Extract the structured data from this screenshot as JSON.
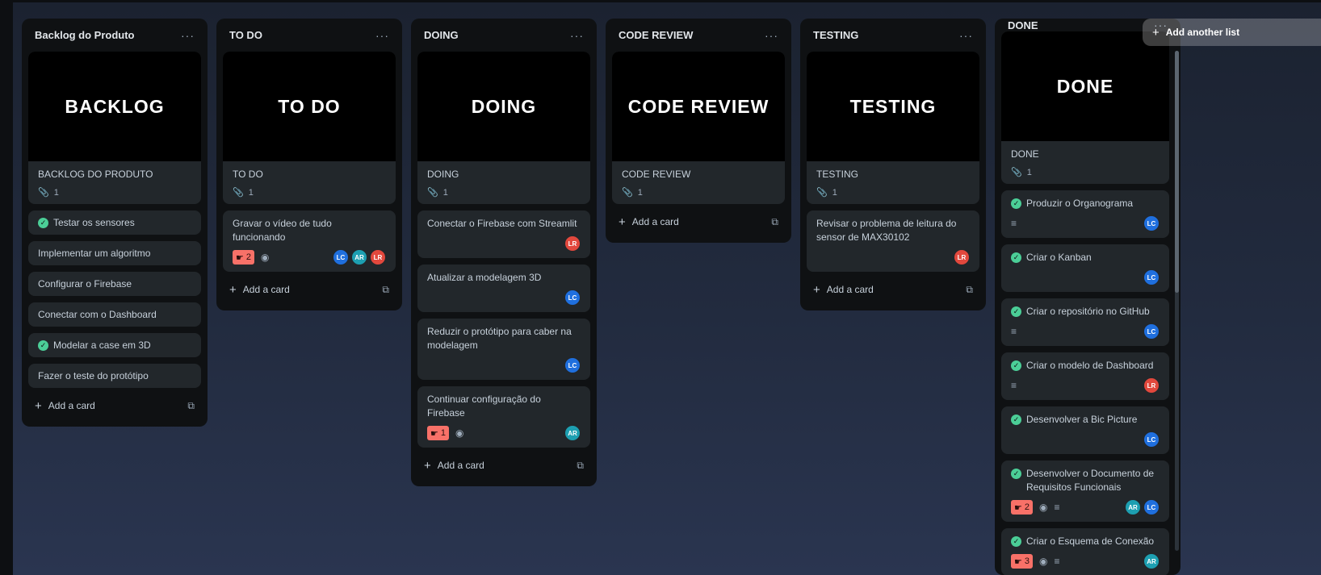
{
  "lists": [
    {
      "title": "Backlog do Produto",
      "cover_text": "BACKLOG",
      "cover_title": "BACKLOG DO PRODUTO",
      "attachments": "1",
      "cards": [
        {
          "title": "Testar os sensores",
          "done": true
        },
        {
          "title": "Implementar um algoritmo",
          "done": false
        },
        {
          "title": "Configurar o Firebase",
          "done": false
        },
        {
          "title": "Conectar com o Dashboard",
          "done": false
        },
        {
          "title": "Modelar a case em 3D",
          "done": true
        },
        {
          "title": "Fazer o teste do protótipo",
          "done": false
        }
      ],
      "add_card": "Add a card"
    },
    {
      "title": "TO DO",
      "cover_text": "TO DO",
      "cover_title": "TO DO",
      "attachments": "1",
      "cards": [
        {
          "title": "Gravar o vídeo de tudo funcionando",
          "badge": "2",
          "avatars": [
            "LC",
            "AR",
            "LR"
          ]
        }
      ],
      "add_card": "Add a card"
    },
    {
      "title": "DOING",
      "cover_text": "DOING",
      "cover_title": "DOING",
      "attachments": "1",
      "cards": [
        {
          "title": "Conectar o Firebase com Streamlit",
          "avatars": [
            "LR"
          ]
        },
        {
          "title": "Atualizar a modelagem 3D",
          "avatars": [
            "LC"
          ]
        },
        {
          "title": "Reduzir o protótipo para caber na modelagem",
          "avatars": [
            "LC"
          ]
        },
        {
          "title": "Continuar configuração do Firebase",
          "badge": "1",
          "avatars": [
            "AR"
          ]
        }
      ],
      "add_card": "Add a card"
    },
    {
      "title": "CODE REVIEW",
      "cover_text": "CODE REVIEW",
      "cover_title": "CODE REVIEW",
      "attachments": "1",
      "add_card": "Add a card"
    },
    {
      "title": "TESTING",
      "cover_text": "TESTING",
      "cover_title": "TESTING",
      "attachments": "1",
      "cards": [
        {
          "title": "Revisar o problema de leitura do sensor de MAX30102",
          "avatars": [
            "LR"
          ]
        }
      ],
      "add_card": "Add a card"
    },
    {
      "title": "DONE",
      "cover_text": "DONE",
      "cover_title": "DONE",
      "attachments": "1",
      "cards": [
        {
          "title": "Produzir o Organograma",
          "avatars": [
            "LC"
          ]
        },
        {
          "title": "Criar o Kanban",
          "avatars": [
            "LC"
          ]
        },
        {
          "title": "Criar o repositório no GitHub",
          "avatars": [
            "LC"
          ]
        },
        {
          "title": "Criar o modelo de Dashboard",
          "avatars": [
            "LR"
          ]
        },
        {
          "title": "Desenvolver a Bic Picture",
          "avatars": [
            "LC"
          ]
        },
        {
          "title": "Desenvolver o Documento de Requisitos Funcionais",
          "badge": "2",
          "avatars": [
            "AR",
            "LC"
          ]
        },
        {
          "title": "Criar o Esquema de Conexão",
          "badge": "3",
          "avatars": [
            "AR"
          ]
        }
      ]
    }
  ],
  "add_list": "Add another list",
  "menu_glyph": "···",
  "icons": {
    "attachment": "paperclip-icon",
    "check": "check-circle-icon",
    "watch": "eye-icon",
    "description": "description-icon",
    "template": "template-icon",
    "badge": "tag-icon"
  },
  "colors": {
    "check": "#4bce97",
    "badge": "#f87168",
    "avatar_lc": "#1f6fde",
    "avatar_ar": "#1d9fb1",
    "avatar_lr": "#e2483d"
  }
}
